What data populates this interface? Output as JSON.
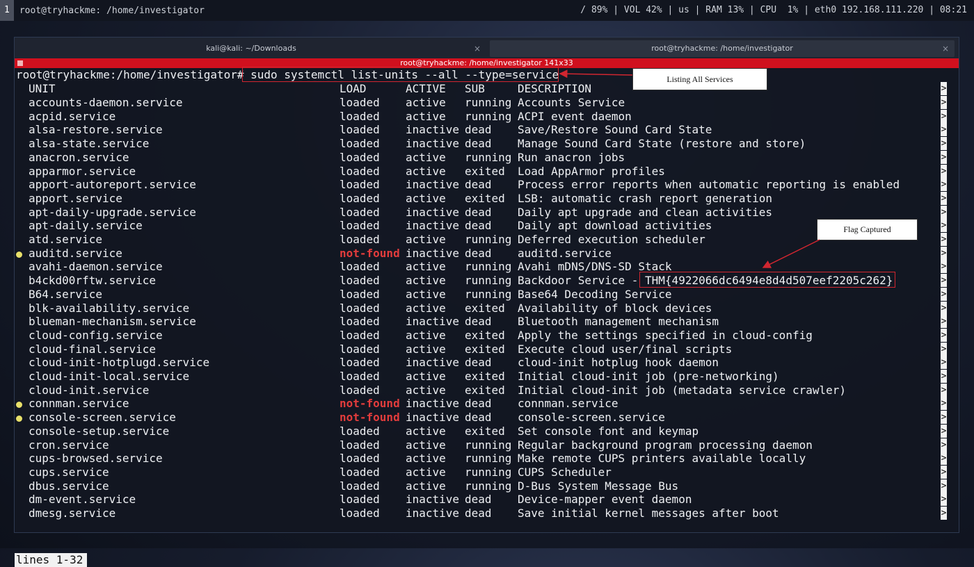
{
  "statusbar": {
    "workspace": "1",
    "title": "root@tryhackme: /home/investigator",
    "right": "/ 89% | VOL 42% | us | RAM 13% | CPU  1% | eth0 192.168.111.220 | 08:21"
  },
  "tabs": [
    {
      "label": "kali@kali: ~/Downloads",
      "close": "×"
    },
    {
      "label": "root@tryhackme: /home/investigator",
      "close": "×"
    }
  ],
  "redbar_title": "root@tryhackme: /home/investigator 141x33",
  "prompt": "root@tryhackme:/home/investigator# ",
  "command": "sudo systemctl list-units --all --type=service",
  "headers": {
    "unit": "UNIT",
    "load": "LOAD",
    "active": "ACTIVE",
    "sub": "SUB",
    "description": "DESCRIPTION"
  },
  "rows": [
    {
      "unit": "accounts-daemon.service",
      "load": "loaded",
      "active": "active",
      "sub": "running",
      "description": "Accounts Service"
    },
    {
      "unit": "acpid.service",
      "load": "loaded",
      "active": "active",
      "sub": "running",
      "description": "ACPI event daemon"
    },
    {
      "unit": "alsa-restore.service",
      "load": "loaded",
      "active": "inactive",
      "sub": "dead",
      "description": "Save/Restore Sound Card State"
    },
    {
      "unit": "alsa-state.service",
      "load": "loaded",
      "active": "inactive",
      "sub": "dead",
      "description": "Manage Sound Card State (restore and store)"
    },
    {
      "unit": "anacron.service",
      "load": "loaded",
      "active": "active",
      "sub": "running",
      "description": "Run anacron jobs"
    },
    {
      "unit": "apparmor.service",
      "load": "loaded",
      "active": "active",
      "sub": "exited",
      "description": "Load AppArmor profiles"
    },
    {
      "unit": "apport-autoreport.service",
      "load": "loaded",
      "active": "inactive",
      "sub": "dead",
      "description": "Process error reports when automatic reporting is enabled"
    },
    {
      "unit": "apport.service",
      "load": "loaded",
      "active": "active",
      "sub": "exited",
      "description": "LSB: automatic crash report generation"
    },
    {
      "unit": "apt-daily-upgrade.service",
      "load": "loaded",
      "active": "inactive",
      "sub": "dead",
      "description": "Daily apt upgrade and clean activities"
    },
    {
      "unit": "apt-daily.service",
      "load": "loaded",
      "active": "inactive",
      "sub": "dead",
      "description": "Daily apt download activities"
    },
    {
      "unit": "atd.service",
      "load": "loaded",
      "active": "active",
      "sub": "running",
      "description": "Deferred execution scheduler"
    },
    {
      "unit": "auditd.service",
      "load": "not-found",
      "active": "inactive",
      "sub": "dead",
      "description": "auditd.service",
      "dot": true
    },
    {
      "unit": "avahi-daemon.service",
      "load": "loaded",
      "active": "active",
      "sub": "running",
      "description": "Avahi mDNS/DNS-SD Stack"
    },
    {
      "unit": "b4ckd00rftw.service",
      "load": "loaded",
      "active": "active",
      "sub": "running",
      "description": "Backdoor Service - THM{4922066dc6494e8d4d507eef2205c262}"
    },
    {
      "unit": "B64.service",
      "load": "loaded",
      "active": "active",
      "sub": "running",
      "description": "Base64 Decoding Service"
    },
    {
      "unit": "blk-availability.service",
      "load": "loaded",
      "active": "active",
      "sub": "exited",
      "description": "Availability of block devices"
    },
    {
      "unit": "blueman-mechanism.service",
      "load": "loaded",
      "active": "inactive",
      "sub": "dead",
      "description": "Bluetooth management mechanism"
    },
    {
      "unit": "cloud-config.service",
      "load": "loaded",
      "active": "active",
      "sub": "exited",
      "description": "Apply the settings specified in cloud-config"
    },
    {
      "unit": "cloud-final.service",
      "load": "loaded",
      "active": "active",
      "sub": "exited",
      "description": "Execute cloud user/final scripts"
    },
    {
      "unit": "cloud-init-hotplugd.service",
      "load": "loaded",
      "active": "inactive",
      "sub": "dead",
      "description": "cloud-init hotplug hook daemon"
    },
    {
      "unit": "cloud-init-local.service",
      "load": "loaded",
      "active": "active",
      "sub": "exited",
      "description": "Initial cloud-init job (pre-networking)"
    },
    {
      "unit": "cloud-init.service",
      "load": "loaded",
      "active": "active",
      "sub": "exited",
      "description": "Initial cloud-init job (metadata service crawler)"
    },
    {
      "unit": "connman.service",
      "load": "not-found",
      "active": "inactive",
      "sub": "dead",
      "description": "connman.service",
      "dot": true
    },
    {
      "unit": "console-screen.service",
      "load": "not-found",
      "active": "inactive",
      "sub": "dead",
      "description": "console-screen.service",
      "dot": true
    },
    {
      "unit": "console-setup.service",
      "load": "loaded",
      "active": "active",
      "sub": "exited",
      "description": "Set console font and keymap"
    },
    {
      "unit": "cron.service",
      "load": "loaded",
      "active": "active",
      "sub": "running",
      "description": "Regular background program processing daemon"
    },
    {
      "unit": "cups-browsed.service",
      "load": "loaded",
      "active": "active",
      "sub": "running",
      "description": "Make remote CUPS printers available locally"
    },
    {
      "unit": "cups.service",
      "load": "loaded",
      "active": "active",
      "sub": "running",
      "description": "CUPS Scheduler"
    },
    {
      "unit": "dbus.service",
      "load": "loaded",
      "active": "active",
      "sub": "running",
      "description": "D-Bus System Message Bus"
    },
    {
      "unit": "dm-event.service",
      "load": "loaded",
      "active": "inactive",
      "sub": "dead",
      "description": "Device-mapper event daemon"
    },
    {
      "unit": "dmesg.service",
      "load": "loaded",
      "active": "inactive",
      "sub": "dead",
      "description": "Save initial kernel messages after boot"
    }
  ],
  "more_marker": ">",
  "footer": "lines 1-32",
  "annotations": {
    "listing": "Listing All Services",
    "flag": "Flag Captured"
  },
  "colors": {
    "titlebar": "#d0101e",
    "annotation": "#d12630",
    "not_found": "#e23c3c",
    "dot": "#e8e06a"
  }
}
